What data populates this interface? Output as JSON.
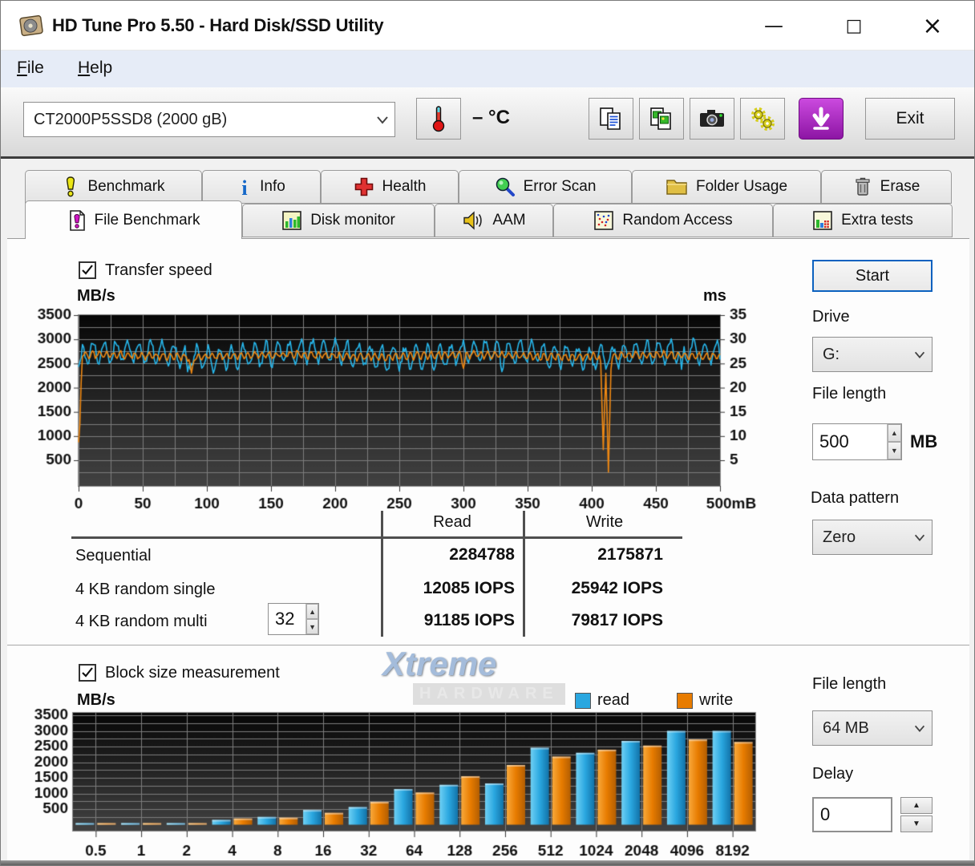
{
  "window": {
    "title": "HD Tune Pro 5.50 - Hard Disk/SSD Utility",
    "controls": {
      "minimize": "—",
      "maximize": "□",
      "close": "×"
    }
  },
  "menu": {
    "items": [
      {
        "label": "File"
      },
      {
        "label": "Help"
      }
    ]
  },
  "toolbar": {
    "drive_select": "CT2000P5SSD8 (2000 gB)",
    "temp_display": "– °C",
    "exit_label": "Exit"
  },
  "tabs": {
    "row1": [
      {
        "label": "Benchmark"
      },
      {
        "label": "Info"
      },
      {
        "label": "Health"
      },
      {
        "label": "Error Scan"
      },
      {
        "label": "Folder Usage"
      },
      {
        "label": "Erase"
      }
    ],
    "row2": [
      {
        "label": "File Benchmark"
      },
      {
        "label": "Disk monitor"
      },
      {
        "label": "AAM"
      },
      {
        "label": "Random Access"
      },
      {
        "label": "Extra tests"
      }
    ],
    "active": "File Benchmark"
  },
  "panel": {
    "transfer_speed_label": "Transfer speed",
    "start_button": "Start",
    "drive_label": "Drive",
    "drive_value": "G:",
    "file_length_label": "File length",
    "file_length_value": "500",
    "file_length_unit": "MB",
    "data_pattern_label": "Data pattern",
    "data_pattern_value": "Zero",
    "results": {
      "col_read": "Read",
      "col_write": "Write",
      "rows": [
        {
          "label": "Sequential",
          "read": "2284788",
          "write": "2175871"
        },
        {
          "label": "4 KB random single",
          "read": "12085 IOPS",
          "write": "25942 IOPS"
        },
        {
          "label": "4 KB random multi",
          "spinner": "32",
          "read": "91185 IOPS",
          "write": "79817 IOPS"
        }
      ]
    },
    "block_size_label": "Block size measurement",
    "legend": {
      "read": "read",
      "write": "write"
    },
    "file_length2_label": "File length",
    "file_length2_value": "64 MB",
    "delay_label": "Delay",
    "delay_value": "0"
  },
  "watermark": {
    "line1": "Xtreme",
    "line2": "HARDWARE"
  },
  "chart_data": [
    {
      "type": "line",
      "title": "Transfer speed",
      "ylabel": "MB/s",
      "y2label": "ms",
      "xlim": [
        0,
        500
      ],
      "ylim": [
        0,
        3500
      ],
      "y2lim": [
        0,
        35
      ],
      "x_suffix": "mB",
      "xticks": [
        0,
        50,
        100,
        150,
        200,
        250,
        300,
        350,
        400,
        450,
        500
      ],
      "yticks": [
        3500,
        3000,
        2500,
        2000,
        1500,
        1000,
        500
      ],
      "y2ticks": [
        35,
        30,
        25,
        20,
        15,
        10,
        5
      ],
      "grid_minor_x": 25,
      "grid_minor_y": 250,
      "series": [
        {
          "name": "read",
          "color": "#27b7ec",
          "baseline": 2690,
          "amplitude": 215,
          "period": 9,
          "noise": 85,
          "seed": 41,
          "keypoints": [
            [
              0,
              2430
            ],
            [
              2,
              2620
            ]
          ],
          "dips": [
            [
              85,
              2330
            ],
            [
              105,
              2300
            ],
            [
              240,
              2360
            ],
            [
              330,
              2330
            ],
            [
              470,
              2380
            ]
          ]
        },
        {
          "name": "write",
          "color": "#ef8812",
          "baseline": 2660,
          "amplitude": 65,
          "period": 5.5,
          "noise": 30,
          "seed": 97,
          "keypoints": [
            [
              0,
              870
            ],
            [
              0.8,
              1400
            ],
            [
              1.4,
              950
            ],
            [
              2.2,
              2480
            ],
            [
              3,
              2650
            ]
          ],
          "dips": [
            [
              88,
              2300
            ],
            [
              300,
              2400
            ],
            [
              409,
              720
            ],
            [
              413,
              255
            ]
          ]
        }
      ]
    },
    {
      "type": "bar",
      "title": "Block size measurement",
      "ylabel": "MB/s",
      "ylim": [
        0,
        3500
      ],
      "yticks": [
        3500,
        3000,
        2500,
        2000,
        1500,
        1000,
        500
      ],
      "categories": [
        "0.5",
        "1",
        "2",
        "4",
        "8",
        "16",
        "32",
        "64",
        "128",
        "256",
        "512",
        "1024",
        "2048",
        "4096",
        "8192"
      ],
      "series": [
        {
          "name": "read",
          "color": "#2aa7e0",
          "values": [
            40,
            45,
            50,
            155,
            250,
            470,
            565,
            1140,
            1275,
            1320,
            2460,
            2300,
            2680,
            3000,
            3000
          ]
        },
        {
          "name": "write",
          "color": "#e87c00",
          "values": [
            40,
            45,
            50,
            200,
            225,
            380,
            730,
            1030,
            1550,
            1910,
            2180,
            2400,
            2530,
            2725,
            2645
          ]
        }
      ],
      "legend_position": "top-right"
    }
  ]
}
